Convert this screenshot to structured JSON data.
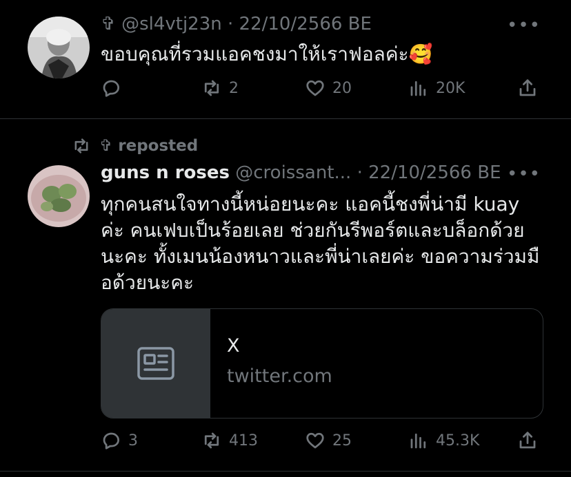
{
  "tweet1": {
    "cross": "✞",
    "handle": "@sl4vtj23n",
    "dot": "·",
    "date": "22/10/2566 BE",
    "text": "ขอบคุณที่รวมแอคชงมาให้เราฟอลค่ะ🥰",
    "actions": {
      "reply": "",
      "repost": "2",
      "like": "20",
      "views": "20K"
    }
  },
  "repost_label": "✞ reposted",
  "tweet2": {
    "name": "guns n roses",
    "handle": "@croissant...",
    "dot": "·",
    "date": "22/10/2566 BE",
    "lines": [
      "ทุกคนสนใจทางนี้หน่อยนะคะ แอคนี้ชงพี่น่ามี kuay",
      "ค่ะ คนเฟบเป็นร้อยเลย ช่วยกันรีพอร์ตและบล็อกด้วย",
      "นะคะ ทั้งเมนน้องหนาวและพี่น่าเลยค่ะ ขอความร่วมมื",
      "อด้วยนะคะ"
    ],
    "card": {
      "title": "X",
      "domain": "twitter.com"
    },
    "actions": {
      "reply": "3",
      "repost": "413",
      "like": "25",
      "views": "45.3K"
    }
  },
  "more": "•••",
  "colors": {
    "bg": "#000000",
    "text": "#e7e9ea",
    "muted": "#71767b",
    "border": "#2f3336"
  }
}
